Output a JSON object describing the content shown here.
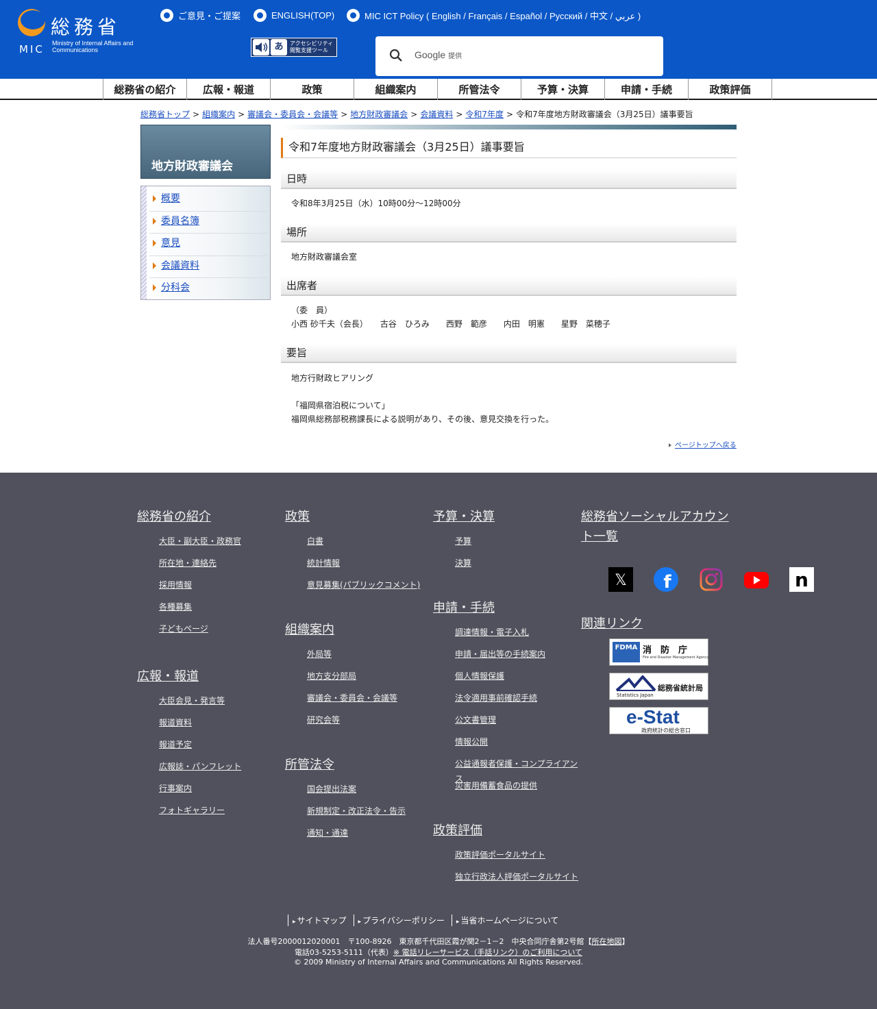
{
  "header": {
    "logo_kanji": "総務省",
    "logo_abbr": "MIC",
    "logo_en": "Ministry of Internal Affairs and Communications",
    "links": [
      "ご意見・ご提案",
      "ENGLISH(TOP)",
      "MIC ICT Policy ( English / Français / Español / Русский / 中文 / عربي )"
    ],
    "accessibility_tool": "アクセシビリティ閲覧支援ツール",
    "accessibility_icon_char": "あ",
    "search": {
      "brand": "Google",
      "suffix": "提供"
    }
  },
  "global_nav": [
    "総務省の紹介",
    "広報・報道",
    "政策",
    "組織案内",
    "所管法令",
    "予算・決算",
    "申請・手続",
    "政策評価"
  ],
  "breadcrumb": {
    "items": [
      "総務省トップ",
      "組織案内",
      "審議会・委員会・会議等",
      "地方財政審議会",
      "会議資料",
      "令和7年度"
    ],
    "separator": ">",
    "current": "令和7年度地方財政審議会（3月25日）議事要旨"
  },
  "sidebar": {
    "title": "地方財政審議会",
    "items": [
      "概要",
      "委員名簿",
      "意見",
      "会議資料",
      "分科会"
    ]
  },
  "main": {
    "title": "令和7年度地方財政審議会（3月25日）議事要旨",
    "sections": [
      {
        "heading": "日時",
        "lines": [
          "令和8年3月25日（水）10時00分～12時00分"
        ]
      },
      {
        "heading": "場所",
        "lines": [
          "地方財政審議会室"
        ]
      },
      {
        "heading": "出席者",
        "lines": [
          "（委　員）",
          "小西 砂千夫（会長）　　古谷　ひろみ　　西野　範彦　　内田　明憲　　星野　菜穂子"
        ]
      },
      {
        "heading": "要旨",
        "lines": [
          "地方行財政ヒアリング",
          "",
          "「福岡県宿泊税について」",
          "福岡県総務部税務課長による説明があり、その後、意見交換を行った。"
        ]
      }
    ],
    "page_top": "ページトップへ戻る"
  },
  "footer": {
    "col1": {
      "groups": [
        {
          "heading": "総務省の紹介",
          "links": [
            "大臣・副大臣・政務官",
            "所在地・連絡先",
            "採用情報",
            "各種募集",
            "子どもページ"
          ]
        },
        {
          "heading": "広報・報道",
          "links": [
            "大臣会見・発言等",
            "報道資料",
            "報道予定",
            "広報誌・パンフレット",
            "行事案内",
            "フォトギャラリー"
          ]
        }
      ]
    },
    "col2": {
      "groups": [
        {
          "heading": "政策",
          "links": [
            "白書",
            "統計情報",
            "意見募集(パブリックコメント)"
          ]
        },
        {
          "heading": "組織案内",
          "links": [
            "外局等",
            "地方支分部局",
            "審議会・委員会・会議等",
            "研究会等"
          ]
        },
        {
          "heading": "所管法令",
          "links": [
            "国会提出法案",
            "新規制定・改正法令・告示",
            "通知・通達"
          ]
        }
      ]
    },
    "col3": {
      "groups": [
        {
          "heading": "予算・決算",
          "links": [
            "予算",
            "決算"
          ]
        },
        {
          "heading": "申請・手続",
          "links": [
            "調達情報・電子入札",
            "申請・届出等の手続案内",
            "個人情報保護",
            "法令適用事前確認手続",
            "公文書管理",
            "情報公開",
            "公益通報者保護・コンプライアンス",
            "災害用備蓄食品の提供"
          ]
        },
        {
          "heading": "政策評価",
          "links": [
            "政策評価ポータルサイト",
            "独立行政法人評価ポータルサイト"
          ]
        }
      ]
    },
    "social": {
      "heading_line1": "総務省ソーシャルアカウン",
      "heading_line2": "ト一覧",
      "accounts": [
        "X",
        "Facebook",
        "Instagram",
        "YouTube",
        "note"
      ],
      "glyphs": {
        "x": "𝕏",
        "facebook": "f",
        "note": "n"
      },
      "colors": {
        "x": "#000000",
        "facebook": "#1877f2",
        "youtube": "#ff0000",
        "note": "#ffffff"
      }
    },
    "related": {
      "heading": "関連リンク",
      "banners": [
        {
          "logo": "FDMA",
          "title": "消　防　庁",
          "sub": "Fire and Disaster Management Agency"
        },
        {
          "title": "総務省統計局",
          "sub": "Statistics Japan"
        },
        {
          "logo_e": "e-",
          "logo_stat": "Stat",
          "sub": "政府統計の総合窓口"
        }
      ]
    },
    "bottom_links": [
      "サイトマップ",
      "プライバシーポリシー",
      "当省ホームページについて"
    ],
    "address_line": "法人番号2000012020001　〒100-8926　東京都千代田区霞が関2－1－2　中央合同庁舎第2号館【",
    "address_link": "所在地図",
    "address_close": "】",
    "phone_prefix": "電話03-5253-5111（代表）",
    "phone_link": "※ 電話リレーサービス（手話リンク）のご利用について",
    "copyright": "© 2009 Ministry of Internal Affairs and Communications All Rights Reserved."
  }
}
